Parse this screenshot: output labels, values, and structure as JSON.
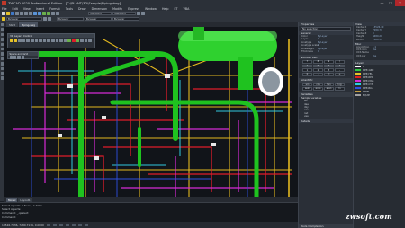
{
  "window": {
    "title": "ZWCAD 2020 Professional Edition - [C:\\PLANT\\3D\\Sample\\Piping.dwg]",
    "controls": {
      "minimize": "—",
      "maximize": "☐",
      "close": "✕"
    }
  },
  "menu": [
    "File",
    "Edit",
    "View",
    "Insert",
    "Format",
    "Tools",
    "Draw",
    "Dimension",
    "Modify",
    "Express",
    "Window",
    "Help",
    "ET",
    "VBA"
  ],
  "toolbar": {
    "layer_combo": "ByLayer",
    "linetype_combo": "ByLayer",
    "lineweight_combo": "ByLayer",
    "textstyle_combo": "Standard",
    "dimstyle_combo": "Standard"
  },
  "doc_tabs": [
    "Start",
    "Piping.dwg"
  ],
  "layer_panel_title": "3D Layers Control",
  "snap_panel_title": "Space and Grid",
  "model_tabs": [
    "Model",
    "Layout1"
  ],
  "command_lines": [
    "Select objects: 1 found, 1 total",
    "Select objects:",
    "Command: _.qselect",
    "Command:"
  ],
  "status": {
    "coords": "13526.7036, 7280.7136, 0.0000"
  },
  "properties": {
    "title": "Properties",
    "selector": "No selection",
    "general_title": "General",
    "general": [
      {
        "k": "Color",
        "v": "ByLayer"
      },
      {
        "k": "Layer",
        "v": "0"
      },
      {
        "k": "Linetype",
        "v": "ByLayer"
      },
      {
        "k": "Linetype scale",
        "v": "1"
      },
      {
        "k": "Lineweight",
        "v": "ByLayer"
      },
      {
        "k": "Thickness",
        "v": "0"
      }
    ],
    "view_title": "View",
    "view": [
      {
        "k": "Center X",
        "v": "13526.70"
      },
      {
        "k": "Center Y",
        "v": "7280.71"
      },
      {
        "k": "Center Z",
        "v": "0"
      },
      {
        "k": "Height",
        "v": "4480.20"
      },
      {
        "k": "Width",
        "v": "7860.51"
      }
    ],
    "misc_title": "Misc",
    "misc": [
      {
        "k": "Annotation",
        "v": "1:1"
      },
      {
        "k": "UCS icon",
        "v": "Yes"
      },
      {
        "k": "UCS Name",
        "v": ""
      },
      {
        "k": "UCS per",
        "v": "Yes"
      }
    ]
  },
  "number_pad": {
    "title": "Number Pad",
    "keys": [
      "7",
      "8",
      "9",
      "/",
      "4",
      "5",
      "6",
      "*",
      "1",
      "2",
      "3",
      "-",
      "0",
      ".",
      "=",
      "+"
    ]
  },
  "scientific": {
    "title": "Scientific",
    "keys": [
      "sin",
      "cos",
      "tan",
      "log",
      "asin",
      "acos",
      "atan",
      "ln"
    ]
  },
  "variables": {
    "title": "Variables",
    "root": "Sample variables",
    "items": [
      "Phi",
      "dee",
      "dxy",
      "nee",
      "rad",
      "vee"
    ],
    "details": "Details"
  },
  "layers_palette": {
    "title": "Layers",
    "items": [
      {
        "name": "0",
        "color": "#ffffff"
      },
      {
        "name": "PIPE-GRN",
        "color": "#2ecc40"
      },
      {
        "name": "PIPE-YEL",
        "color": "#e6c229"
      },
      {
        "name": "PIPE-RED",
        "color": "#e02020"
      },
      {
        "name": "PIPE-MAG",
        "color": "#d62ad6"
      },
      {
        "name": "PIPE-CYN",
        "color": "#2ad0e0"
      },
      {
        "name": "PIPE-BLU",
        "color": "#3050e0"
      },
      {
        "name": "STEEL",
        "color": "#c8a040"
      },
      {
        "name": "EQUIP",
        "color": "#a0a0a0"
      }
    ]
  },
  "tool_palettes_label": "Tools Completion",
  "watermark": "zwsoft.com",
  "colors": {
    "pipe_green": "#1fc21f",
    "pipe_yellow": "#e3b81f",
    "pipe_red": "#e01c2a",
    "pipe_magenta": "#d62ad6",
    "pipe_cyan": "#31c9e0",
    "canvas_bg": "#111419"
  }
}
